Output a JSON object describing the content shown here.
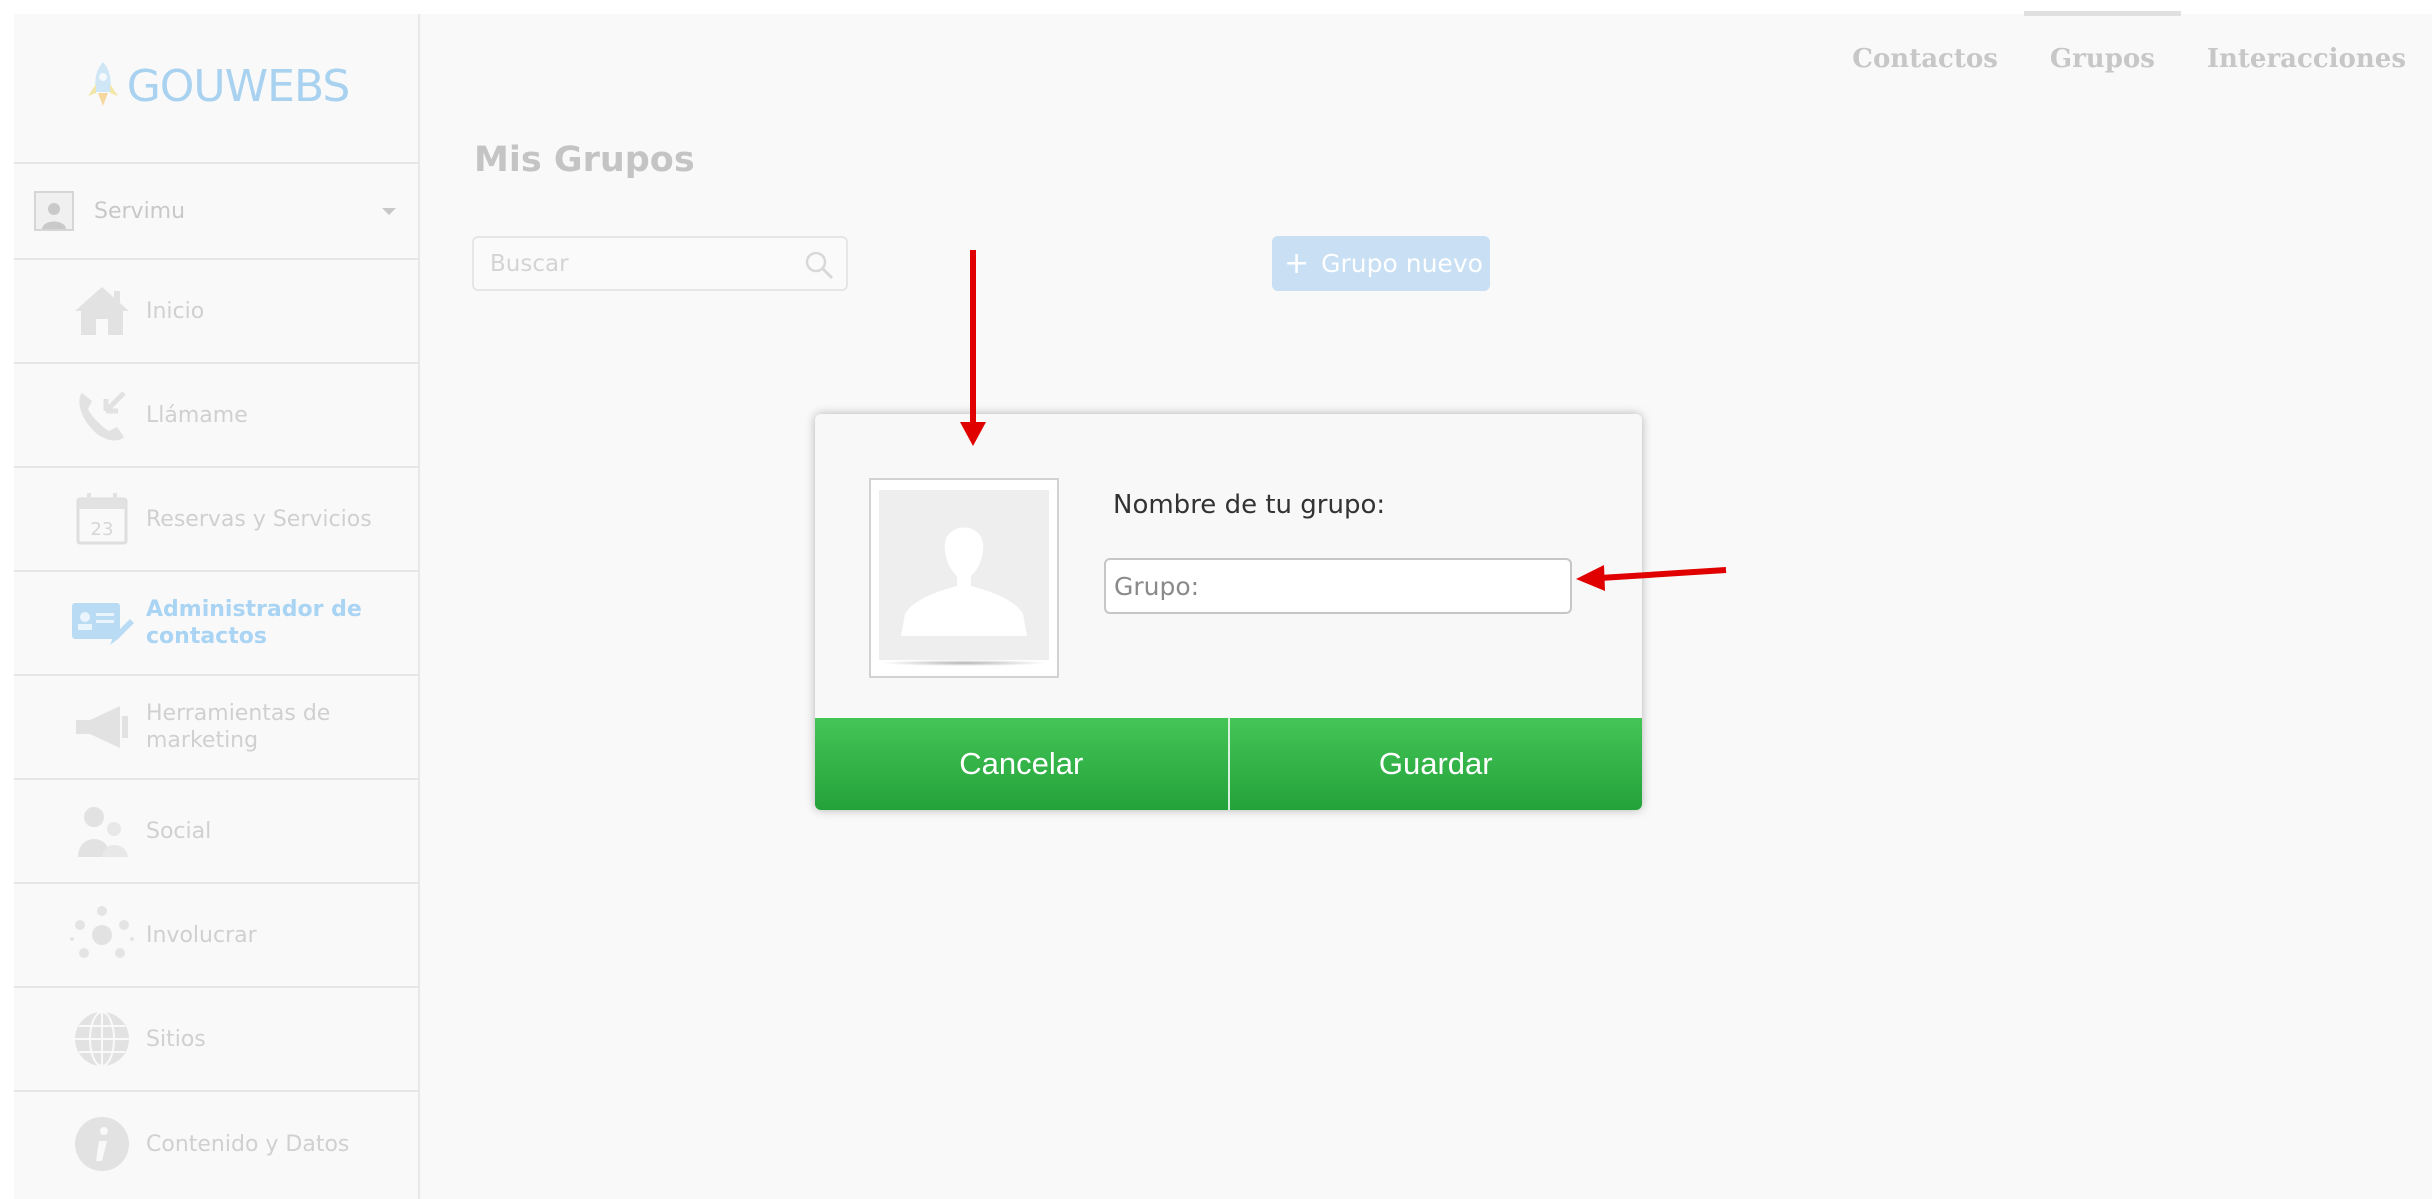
{
  "brand": {
    "logo_text": "GOUWEBS"
  },
  "sidebar": {
    "account_name": "Servimu",
    "items": [
      {
        "label": "Inicio",
        "icon": "home-icon"
      },
      {
        "label": "Llámame",
        "icon": "phone-icon"
      },
      {
        "label": "Reservas y Servicios",
        "icon": "calendar-icon",
        "calendar_day": "23"
      },
      {
        "label": "Administrador de contactos",
        "icon": "contact-card-icon",
        "active": true
      },
      {
        "label": "Herramientas de marketing",
        "icon": "megaphone-icon"
      },
      {
        "label": "Social",
        "icon": "people-icon"
      },
      {
        "label": "Involucrar",
        "icon": "network-icon"
      },
      {
        "label": "Sitios",
        "icon": "globe-icon"
      },
      {
        "label": "Contenido y Datos",
        "icon": "info-icon"
      }
    ]
  },
  "top_nav": {
    "tabs": [
      {
        "label": "Contactos"
      },
      {
        "label": "Grupos",
        "active": true
      },
      {
        "label": "Interacciones"
      }
    ]
  },
  "main": {
    "title": "Mis Grupos",
    "search_placeholder": "Buscar",
    "new_group_plus": "+",
    "new_group_label": "Grupo nuevo"
  },
  "modal": {
    "name_label": "Nombre de tu grupo:",
    "group_placeholder": "Grupo:",
    "cancel_label": "Cancelar",
    "save_label": "Guardar"
  },
  "colors": {
    "accent_green": "#2fb246",
    "annotation_red": "#e00000",
    "brand_blue_faded": "#a8d2f0"
  }
}
